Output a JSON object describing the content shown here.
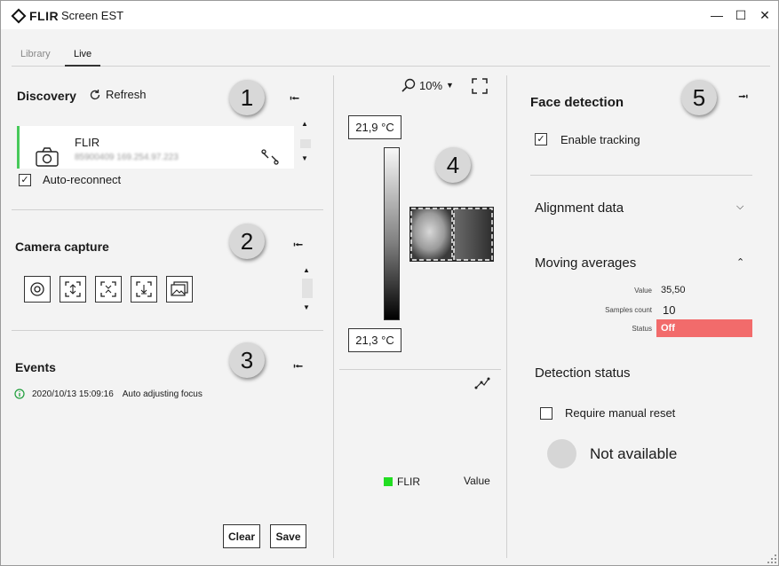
{
  "app": {
    "brand": "FLIR",
    "title": "Screen EST",
    "controls": {
      "minimize": "—",
      "maximize": "☐",
      "close": "✕"
    }
  },
  "tabs": [
    {
      "label": "Library"
    },
    {
      "label": "Live"
    }
  ],
  "discovery": {
    "title": "Discovery",
    "refresh_label": "Refresh",
    "badge": "1",
    "device": {
      "name": "FLIR",
      "details": "85900409 169.254.97.223"
    },
    "auto_reconnect_label": "Auto-reconnect",
    "auto_reconnect_checked": true
  },
  "capture": {
    "title": "Camera capture",
    "badge": "2"
  },
  "events": {
    "title": "Events",
    "badge": "3",
    "items": [
      {
        "timestamp": "2020/10/13 15:09:16",
        "message": "Auto adjusting focus"
      }
    ],
    "clear_label": "Clear",
    "save_label": "Save"
  },
  "viewer": {
    "zoom": "10%",
    "badge": "4",
    "temp_max": "21,9 °C",
    "temp_min": "21,3 °C",
    "legend_name": "FLIR",
    "legend_value": "Value",
    "legend_color": "#22dd22"
  },
  "face": {
    "title": "Face detection",
    "badge": "5",
    "enable_tracking_label": "Enable tracking",
    "enable_tracking_checked": true,
    "alignment_title": "Alignment data",
    "moving_title": "Moving averages",
    "value_key": "Value",
    "value": "35,50",
    "samples_key": "Samples count",
    "samples": "10",
    "status_key": "Status",
    "status": "Off",
    "status_color": "#f26b6b",
    "detection_title": "Detection status",
    "manual_reset_label": "Require manual reset",
    "manual_reset_checked": false,
    "availability": "Not available"
  }
}
